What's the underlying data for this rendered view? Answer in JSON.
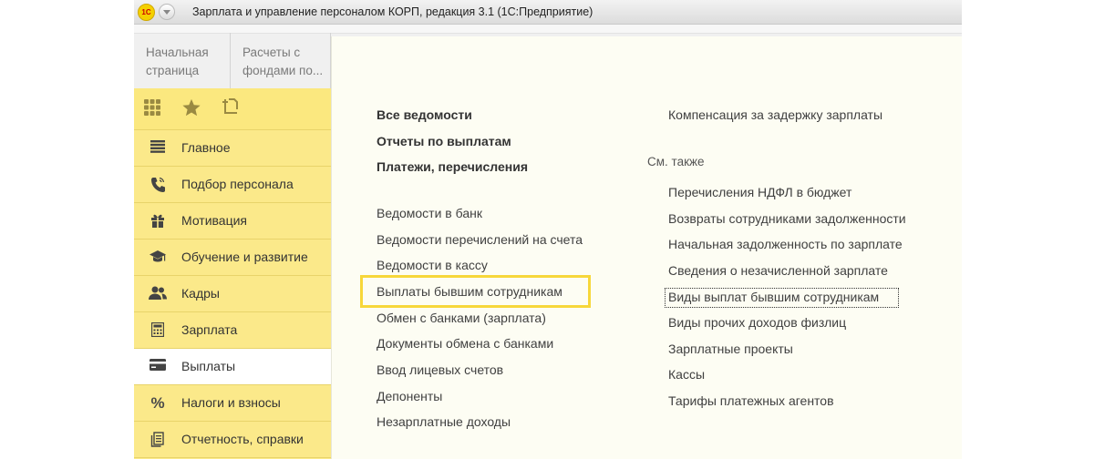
{
  "window": {
    "logo_text": "1С",
    "title": "Зарплата и управление персоналом КОРП, редакция 3.1  (1С:Предприятие)"
  },
  "tabs": [
    {
      "line1": "Начальная",
      "line2": "страница"
    },
    {
      "line1": "Расчеты с",
      "line2": "фондами по..."
    }
  ],
  "sidebar": {
    "top_icons": [
      "apps-grid-icon",
      "star-icon",
      "history-icon"
    ],
    "items": [
      {
        "label": "Главное",
        "icon": "menu-lines-icon",
        "active": false
      },
      {
        "label": "Подбор персонала",
        "icon": "phone-icon",
        "active": false
      },
      {
        "label": "Мотивация",
        "icon": "gift-icon",
        "active": false
      },
      {
        "label": "Обучение и развитие",
        "icon": "graduation-cap-icon",
        "active": false
      },
      {
        "label": "Кадры",
        "icon": "people-icon",
        "active": false
      },
      {
        "label": "Зарплата",
        "icon": "calculator-icon",
        "active": false
      },
      {
        "label": "Выплаты",
        "icon": "card-icon",
        "active": true
      },
      {
        "label": "Налоги и взносы",
        "icon": "percent-icon",
        "active": false
      },
      {
        "label": "Отчетность, справки",
        "icon": "documents-icon",
        "active": false
      }
    ]
  },
  "content": {
    "left_bold": [
      "Все ведомости",
      "Отчеты по выплатам",
      "Платежи, перечисления"
    ],
    "left_links": [
      "Ведомости в банк",
      "Ведомости перечислений на счета",
      "Ведомости в кассу",
      "Выплаты бывшим сотрудникам",
      "Обмен с банками (зарплата)",
      "Документы обмена с банками",
      "Ввод лицевых счетов",
      "Депоненты",
      "Незарплатные доходы"
    ],
    "right_top": "Компенсация за задержку зарплаты",
    "see_also": "См. также",
    "right_links": [
      "Перечисления НДФЛ в бюджет",
      "Возвраты сотрудниками задолженности",
      "Начальная задолженность по зарплате",
      "Сведения о незачисленной зарплате",
      "Виды выплат бывшим сотрудникам",
      "Виды прочих доходов физлиц",
      "Зарплатные проекты",
      "Кассы",
      "Тарифы платежных агентов"
    ]
  },
  "colors": {
    "sidebar_bg": "#fbe98a",
    "content_bg": "#fdfdf3",
    "highlight": "#f7d73a"
  }
}
